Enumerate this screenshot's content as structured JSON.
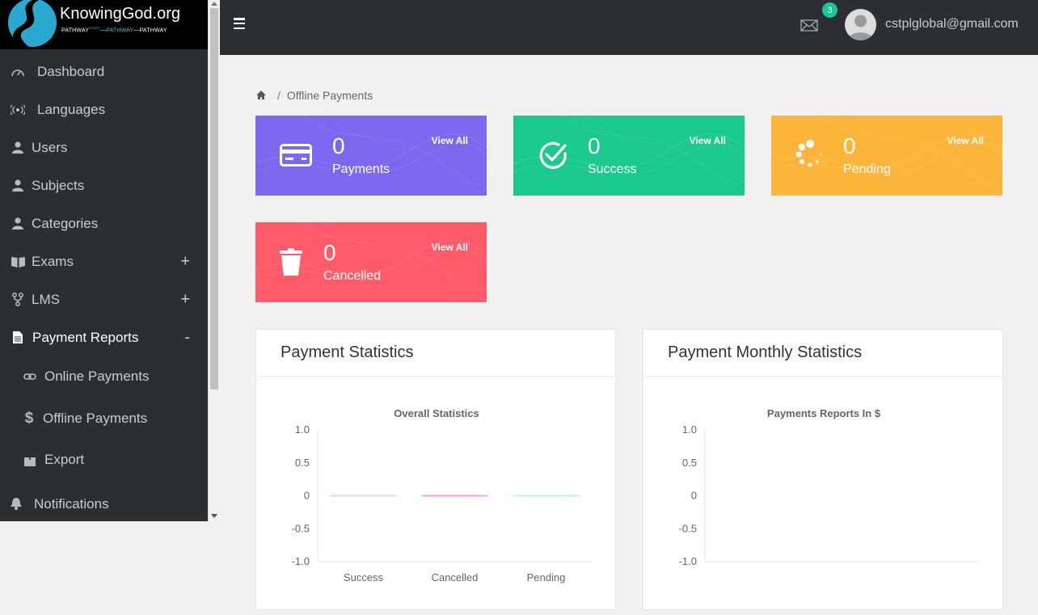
{
  "brand": {
    "name": "KnowingGod.org",
    "tagline_parts": [
      "PATHWAY",
      "START",
      "PATHWAY",
      "PATHWAY"
    ]
  },
  "sidebar": {
    "items": [
      {
        "label": "Dashboard",
        "icon": "dashboard-icon"
      },
      {
        "label": "Languages",
        "icon": "broadcast-icon"
      },
      {
        "label": "Users",
        "icon": "user-icon"
      },
      {
        "label": "Subjects",
        "icon": "user-icon"
      },
      {
        "label": "Categories",
        "icon": "user-icon"
      },
      {
        "label": "Exams",
        "icon": "book-icon",
        "toggle": "+"
      },
      {
        "label": "LMS",
        "icon": "fork-icon",
        "toggle": "+"
      },
      {
        "label": "Payment Reports",
        "icon": "document-icon",
        "toggle": "-"
      },
      {
        "label": "Notifications",
        "icon": "bell-icon"
      }
    ],
    "sub_items": [
      {
        "label": "Online Payments",
        "icon": "link-icon"
      },
      {
        "label": "Offline Payments",
        "icon": "dollar-icon"
      },
      {
        "label": "Export",
        "icon": "export-icon"
      }
    ]
  },
  "topbar": {
    "notification_count": "3",
    "user_email": "cstplglobal@gmail.com"
  },
  "breadcrumb": {
    "separator": "/",
    "current": "Offline Payments"
  },
  "cards": [
    {
      "value": "0",
      "label": "Payments",
      "link": "View All",
      "color": "#7b68ee"
    },
    {
      "value": "0",
      "label": "Success",
      "link": "View All",
      "color": "#1bc98e"
    },
    {
      "value": "0",
      "label": "Pending",
      "link": "View All",
      "color": "#fdb43b"
    },
    {
      "value": "0",
      "label": "Cancelled",
      "link": "View All",
      "color": "#ff5b6b"
    }
  ],
  "panels": {
    "left_title": "Payment Statistics",
    "right_title": "Payment Monthly Statistics"
  },
  "chart_data": [
    {
      "type": "bar",
      "title": "Overall Statistics",
      "categories": [
        "Success",
        "Cancelled",
        "Pending"
      ],
      "values": [
        0,
        0,
        0
      ],
      "colors": [
        "#f5d0e0",
        "#f5a0f0",
        "#b8f5e6"
      ],
      "ylim": [
        -1.0,
        1.0
      ],
      "yticks": [
        "1.0",
        "0.5",
        "0",
        "-0.5",
        "-1.0"
      ],
      "xlabel": "",
      "ylabel": ""
    },
    {
      "type": "bar",
      "title": "Payments Reports In $",
      "categories": [],
      "values": [],
      "ylim": [
        -1.0,
        1.0
      ],
      "yticks": [
        "1.0",
        "0.5",
        "0",
        "-0.5",
        "-1.0"
      ],
      "xlabel": "",
      "ylabel": ""
    }
  ]
}
